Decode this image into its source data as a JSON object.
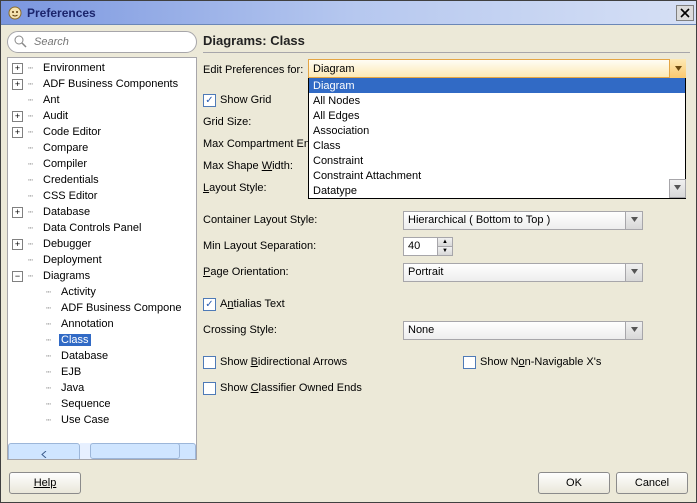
{
  "window": {
    "title": "Preferences",
    "close": "X"
  },
  "search": {
    "placeholder": "Search"
  },
  "tree": {
    "items": [
      {
        "label": "Environment",
        "exp": "+",
        "depth": 0
      },
      {
        "label": "ADF Business Components",
        "exp": "+",
        "depth": 0
      },
      {
        "label": "Ant",
        "exp": "",
        "depth": 0,
        "leaf": true
      },
      {
        "label": "Audit",
        "exp": "+",
        "depth": 0
      },
      {
        "label": "Code Editor",
        "exp": "+",
        "depth": 0
      },
      {
        "label": "Compare",
        "exp": "",
        "depth": 0,
        "leaf": true
      },
      {
        "label": "Compiler",
        "exp": "",
        "depth": 0,
        "leaf": true
      },
      {
        "label": "Credentials",
        "exp": "",
        "depth": 0,
        "leaf": true
      },
      {
        "label": "CSS Editor",
        "exp": "",
        "depth": 0,
        "leaf": true
      },
      {
        "label": "Database",
        "exp": "+",
        "depth": 0
      },
      {
        "label": "Data Controls Panel",
        "exp": "",
        "depth": 0,
        "leaf": true
      },
      {
        "label": "Debugger",
        "exp": "+",
        "depth": 0
      },
      {
        "label": "Deployment",
        "exp": "",
        "depth": 0,
        "leaf": true
      },
      {
        "label": "Diagrams",
        "exp": "−",
        "depth": 0
      },
      {
        "label": "Activity",
        "exp": "",
        "depth": 1,
        "leaf": true
      },
      {
        "label": "ADF Business Compone",
        "exp": "",
        "depth": 1,
        "leaf": true
      },
      {
        "label": "Annotation",
        "exp": "",
        "depth": 1,
        "leaf": true
      },
      {
        "label": "Class",
        "exp": "",
        "depth": 1,
        "leaf": true,
        "selected": true
      },
      {
        "label": "Database",
        "exp": "",
        "depth": 1,
        "leaf": true
      },
      {
        "label": "EJB",
        "exp": "",
        "depth": 1,
        "leaf": true
      },
      {
        "label": "Java",
        "exp": "",
        "depth": 1,
        "leaf": true
      },
      {
        "label": "Sequence",
        "exp": "",
        "depth": 1,
        "leaf": true
      },
      {
        "label": "Use Case",
        "exp": "",
        "depth": 1,
        "leaf": true
      }
    ]
  },
  "panel": {
    "title": "Diagrams: Class",
    "editPrefsLabel": "Edit Preferences for:",
    "editPrefsValue": "Diagram",
    "options": [
      "Diagram",
      "All Nodes",
      "All Edges",
      "Association",
      "Class",
      "Constraint",
      "Constraint Attachment",
      "Datatype"
    ],
    "showGrid": {
      "label": "Show Grid",
      "checked": true
    },
    "gridSize": "Grid Size:",
    "maxCompEntries": "Max Compartment En",
    "maxShapeWidth": "Max Shape Width:",
    "layoutStyle": "Layout Style:",
    "containerLayout": {
      "label": "Container Layout Style:",
      "value": "Hierarchical ( Bottom to Top )"
    },
    "minLayoutSep": {
      "label": "Min Layout Separation:",
      "value": "40"
    },
    "pageOrientation": {
      "label": "Page Orientation:",
      "value": "Portrait"
    },
    "antialias": {
      "label": "Antialias Text",
      "checked": true
    },
    "crossingStyle": {
      "label": "Crossing Style:",
      "value": "None"
    },
    "showBidi": {
      "label": "Show Bidirectional Arrows",
      "checked": false
    },
    "showNonNav": {
      "label": "Show Non-Navigable X's",
      "checked": false
    },
    "showClassifier": {
      "label": "Show Classifier Owned Ends",
      "checked": false
    }
  },
  "footer": {
    "help": "Help",
    "ok": "OK",
    "cancel": "Cancel"
  }
}
